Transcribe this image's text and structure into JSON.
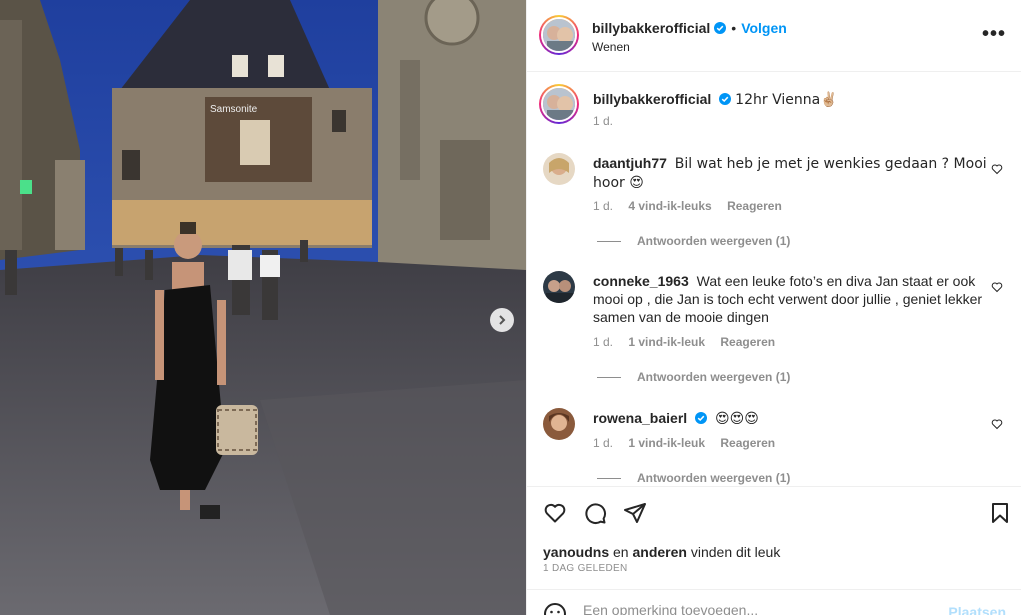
{
  "post": {
    "author": "billybakkerofficial",
    "follow_label": "Volgen",
    "location": "Wenen",
    "caption": "12hr Vienna✌🏼",
    "caption_time": "1 d.",
    "more_label": "•••"
  },
  "photo": {
    "billboard_text": "Samsonite",
    "next_icon": "chevron-right-icon"
  },
  "comments": [
    {
      "username": "daantjuh77",
      "text": "Bil wat heb je met je wenkies gedaan ? Mooi hoor 😍",
      "time": "1 d.",
      "likes": "4 vind-ik-leuks",
      "reply": "Reageren",
      "view_replies": "Antwoorden weergeven (1)"
    },
    {
      "username": "conneke_1963",
      "text": "Wat een leuke foto’s en diva Jan staat er ook mooi op , die Jan is toch echt verwent door jullie , geniet lekker samen van de mooie dingen",
      "time": "1 d.",
      "likes": "1 vind-ik-leuk",
      "reply": "Reageren",
      "view_replies": "Antwoorden weergeven (1)"
    },
    {
      "username": "rowena_baierl",
      "text": "😍😍😍",
      "time": "1 d.",
      "likes": "1 vind-ik-leuk",
      "reply": "Reageren",
      "view_replies": "Antwoorden weergeven (1)"
    }
  ],
  "likes_line": {
    "user": "yanoudns",
    "connector": "en",
    "others": "anderen",
    "suffix": "vinden dit leuk"
  },
  "time_ago": "1 DAG GELEDEN",
  "comment_box": {
    "placeholder": "Een opmerking toevoegen...",
    "post_label": "Plaatsen"
  },
  "colors": {
    "accent": "#0095f6",
    "verified": "#0095f6",
    "muted": "#8e8e8e"
  }
}
